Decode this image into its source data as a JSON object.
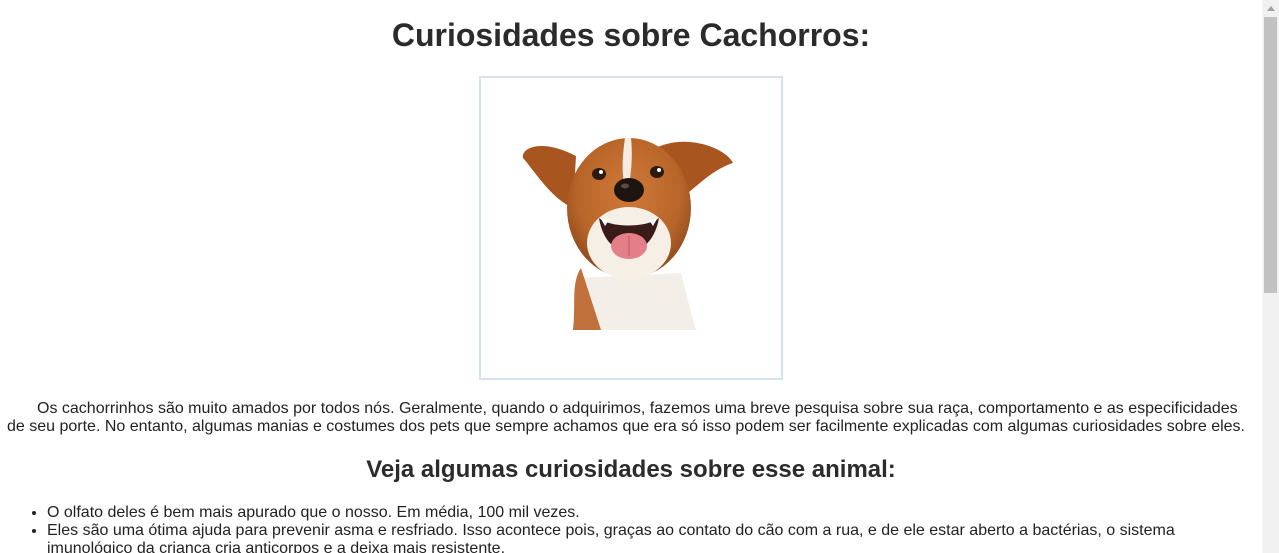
{
  "page": {
    "title": "Curiosidades sobre Cachorros:",
    "image_alt": "Filhote de cachorro sorridente",
    "intro": "Os cachorrinhos são muito amados por todos nós. Geralmente, quando o adquirimos, fazemos uma breve pesquisa sobre sua raça, comportamento e as especificidades de seu porte. No entanto, algumas manias e costumes dos pets que sempre achamos que era só isso podem ser facilmente explicadas com algumas curiosidades sobre eles.",
    "subtitle": "Veja algumas curiosidades sobre esse animal:",
    "facts": [
      "O olfato deles é bem mais apurado que o nosso. Em média, 100 mil vezes.",
      "Eles são uma ótima ajuda para prevenir asma e resfriado. Isso acontece pois, graças ao contato do cão com a rua, e de ele estar aberto a bactérias, o sistema imunológico da criança cria anticorpos e a deixa mais resistente."
    ]
  },
  "colors": {
    "frame_border": "#d4e3ea",
    "fur": "#b8652a",
    "scrollbar_track": "#f1f1f1",
    "scrollbar_thumb": "#c1c1c1"
  }
}
